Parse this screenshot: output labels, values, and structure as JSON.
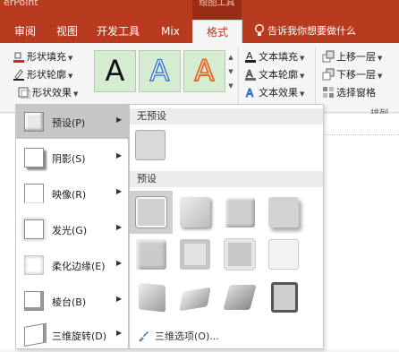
{
  "app": {
    "title": "erPoint",
    "context_group": "绘图工具"
  },
  "tabs": [
    {
      "label": "审阅"
    },
    {
      "label": "视图"
    },
    {
      "label": "开发工具"
    },
    {
      "label": "Mix"
    },
    {
      "label": "格式",
      "active": true
    }
  ],
  "tell_me": {
    "text": "告诉我你想要做什么"
  },
  "ribbon": {
    "shape_fill": "形状填充",
    "shape_outline": "形状轮廓",
    "shape_effects": "形状效果",
    "wordart_glyph": "A",
    "text_fill": "文本填充",
    "text_outline": "文本轮廓",
    "text_effects": "文本效果",
    "bring_forward": "上移一层",
    "send_backward": "下移一层",
    "selection_pane": "选择窗格",
    "arrange_group": "排列"
  },
  "effects_menu": {
    "items": [
      {
        "label": "预设(P)",
        "highlighted": true
      },
      {
        "label": "阴影(S)"
      },
      {
        "label": "映像(R)"
      },
      {
        "label": "发光(G)"
      },
      {
        "label": "柔化边缘(E)"
      },
      {
        "label": "棱台(B)"
      },
      {
        "label": "三维旋转(D)"
      }
    ]
  },
  "preset_panel": {
    "no_preset_header": "无预设",
    "preset_header": "预设",
    "options_label": "三维选项(O)...",
    "preset_count": 12
  },
  "colors": {
    "accent": "#b83a1f",
    "wordart_fill": "#d5ecd1"
  }
}
